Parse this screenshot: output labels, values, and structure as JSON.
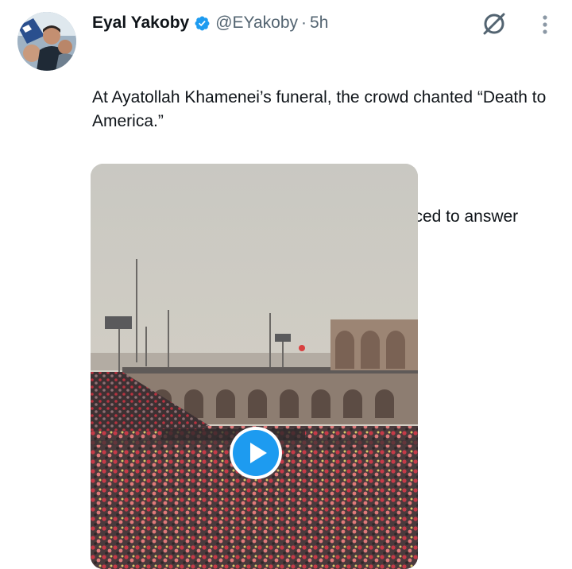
{
  "author": {
    "name": "Eyal Yakoby",
    "handle": "@EYakoby",
    "separator": "·",
    "time": "5h"
  },
  "tweet": {
    "paragraph1": "At Ayatollah Khamenei’s funeral, the crowd chanted “Death to America.”",
    "paragraph2": "Every U.S. ‘ally’ who attended should be forced to answer questions."
  },
  "icons": {
    "verified": "verified-badge-icon",
    "grok": "grok-icon",
    "more": "more-vertical-icon",
    "play": "play-icon"
  },
  "colors": {
    "verified_blue": "#1d9bf0",
    "play_blue": "#1d9bf0",
    "secondary_text": "#536471"
  }
}
